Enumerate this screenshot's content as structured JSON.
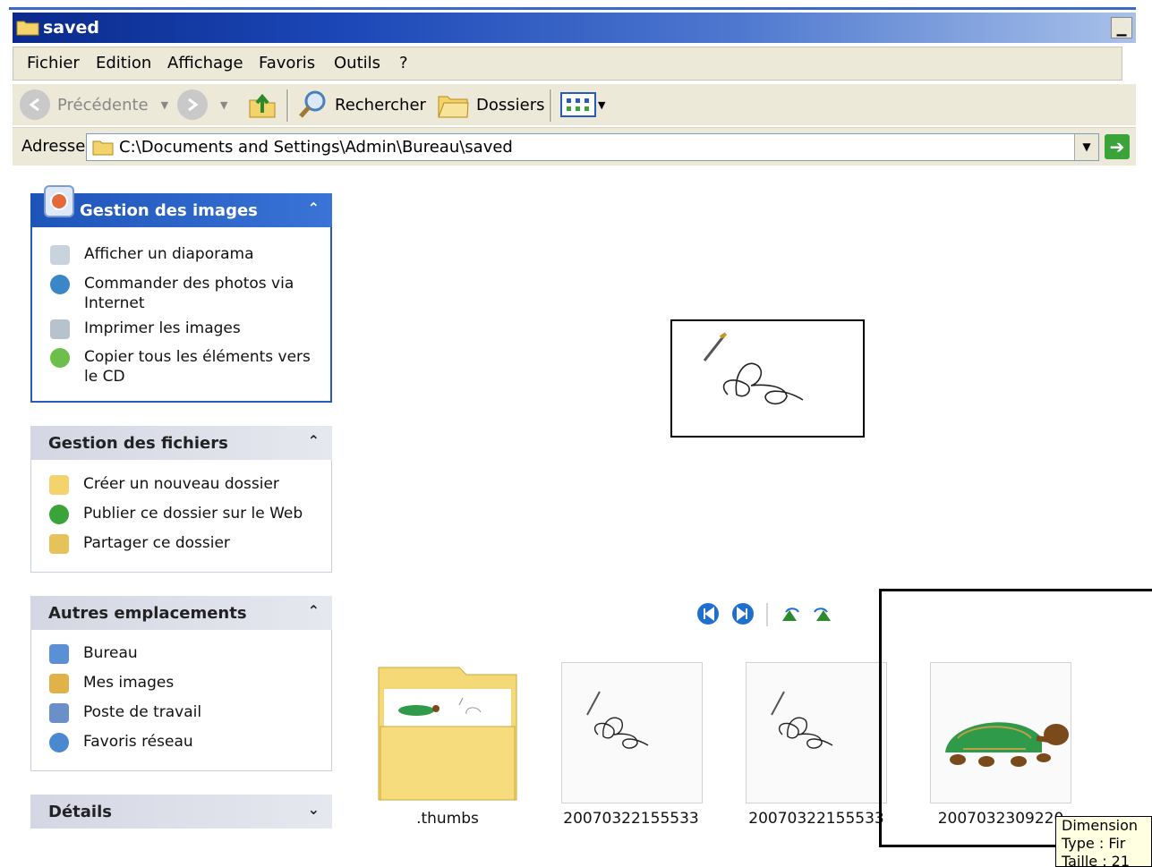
{
  "window": {
    "title": "saved"
  },
  "menu": [
    "Fichier",
    "Edition",
    "Affichage",
    "Favoris",
    "Outils",
    "?"
  ],
  "toolbar": {
    "back_label": "Précédente",
    "search_label": "Rechercher",
    "folders_label": "Dossiers"
  },
  "address": {
    "label": "Adresse",
    "path": "C:\\Documents and Settings\\Admin\\Bureau\\saved"
  },
  "panels": {
    "images": {
      "title": "Gestion des images",
      "items": [
        "Afficher un diaporama",
        "Commander des photos via Internet",
        "Imprimer les images",
        "Copier tous les éléments vers le CD"
      ]
    },
    "files": {
      "title": "Gestion des fichiers",
      "items": [
        "Créer un nouveau dossier",
        "Publier ce dossier sur le Web",
        "Partager ce dossier"
      ]
    },
    "places": {
      "title": "Autres emplacements",
      "items": [
        "Bureau",
        "Mes images",
        "Poste de travail",
        "Favoris réseau"
      ]
    },
    "details": {
      "title": "Détails"
    }
  },
  "files": [
    {
      "name": ".thumbs"
    },
    {
      "name": "20070322155533"
    },
    {
      "name": "20070322155533"
    },
    {
      "name": "2007032309220"
    }
  ],
  "tooltip": [
    "Dimension",
    "Type : Fir",
    "Taille : 21"
  ],
  "colors": {
    "titlebar": "#0a2a8c",
    "panel_head": "#1d54b8",
    "chrome": "#ece9d8"
  }
}
